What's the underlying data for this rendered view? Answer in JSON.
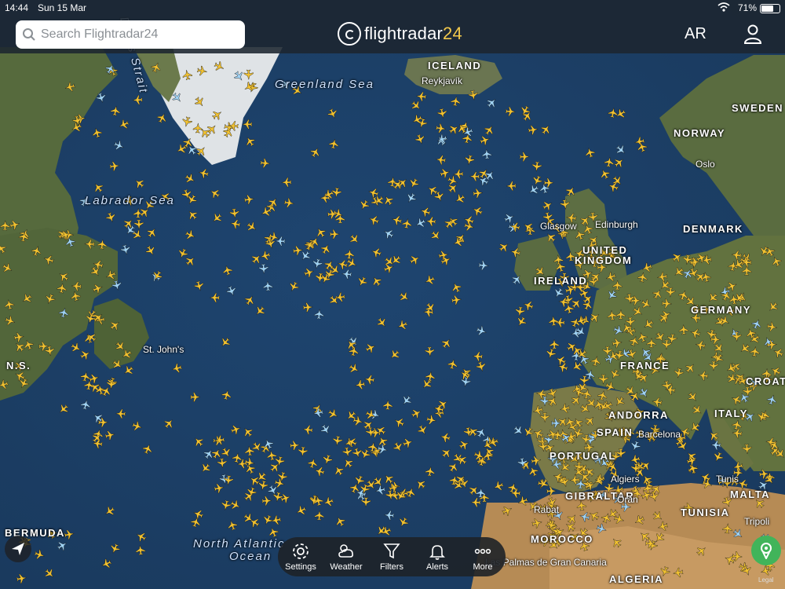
{
  "status_bar": {
    "time": "14:44",
    "date": "Sun 15 Mar",
    "battery": "71%"
  },
  "search": {
    "placeholder": "Search Flightradar24"
  },
  "logo": {
    "name": "flightradar",
    "number": "24"
  },
  "header": {
    "ar_label": "AR"
  },
  "map_labels": [
    {
      "text": "ICELAND",
      "kind": "big"
    },
    {
      "text": "Reykjavík",
      "kind": "city"
    },
    {
      "text": "Greenland Sea",
      "kind": "sea"
    },
    {
      "text": "Labrador Sea",
      "kind": "sea"
    },
    {
      "text": "SWEDEN",
      "kind": "big"
    },
    {
      "text": "NORWAY",
      "kind": "big"
    },
    {
      "text": "Oslo",
      "kind": "city"
    },
    {
      "text": "Glasgow",
      "kind": "city"
    },
    {
      "text": "Edinburgh",
      "kind": "city"
    },
    {
      "text": "UNITED",
      "kind": "big"
    },
    {
      "text": "KINGDOM",
      "kind": "big"
    },
    {
      "text": "DENMARK",
      "kind": "big"
    },
    {
      "text": "IRELAND",
      "kind": "big"
    },
    {
      "text": "FRANCE",
      "kind": "big"
    },
    {
      "text": "GERMANY",
      "kind": "big"
    },
    {
      "text": "CROATIA",
      "kind": "big"
    },
    {
      "text": "ANDORRA",
      "kind": "big"
    },
    {
      "text": "ITALY",
      "kind": "big"
    },
    {
      "text": "SPAIN",
      "kind": "big"
    },
    {
      "text": "Barcelona",
      "kind": "city"
    },
    {
      "text": "PORTUGAL",
      "kind": "big"
    },
    {
      "text": "GIBRALTAR",
      "kind": "big"
    },
    {
      "text": "Algiers",
      "kind": "city"
    },
    {
      "text": "Oran",
      "kind": "city"
    },
    {
      "text": "Tunis",
      "kind": "city"
    },
    {
      "text": "MALTA",
      "kind": "big"
    },
    {
      "text": "TUNISIA",
      "kind": "big"
    },
    {
      "text": "Tripoli",
      "kind": "city"
    },
    {
      "text": "MOROCCO",
      "kind": "big"
    },
    {
      "text": "Rabat",
      "kind": "city"
    },
    {
      "text": "ALGERIA",
      "kind": "big"
    },
    {
      "text": "Las Palmas de Gran Canaria",
      "kind": "city"
    },
    {
      "text": "St. John's",
      "kind": "city"
    },
    {
      "text": "BERMUDA",
      "kind": "big"
    },
    {
      "text": "North Atlantic",
      "kind": "sea"
    },
    {
      "text": "Ocean",
      "kind": "sea"
    },
    {
      "text": "Davis Strait",
      "kind": "sea"
    },
    {
      "text": "N.S.",
      "kind": "big"
    }
  ],
  "toolbar": [
    {
      "label": "Settings",
      "icon": "gear-icon"
    },
    {
      "label": "Weather",
      "icon": "weather-icon"
    },
    {
      "label": "Filters",
      "icon": "filter-icon"
    },
    {
      "label": "Alerts",
      "icon": "bell-icon"
    },
    {
      "label": "More",
      "icon": "more-icon"
    }
  ],
  "legal": "Legal",
  "colors": {
    "ocean": "#1d3f63",
    "land": "#5b6b3c",
    "aircraft": "#f2c230",
    "aircraft_alt": "#9fd3f5",
    "ar_button": "#41b45a"
  }
}
